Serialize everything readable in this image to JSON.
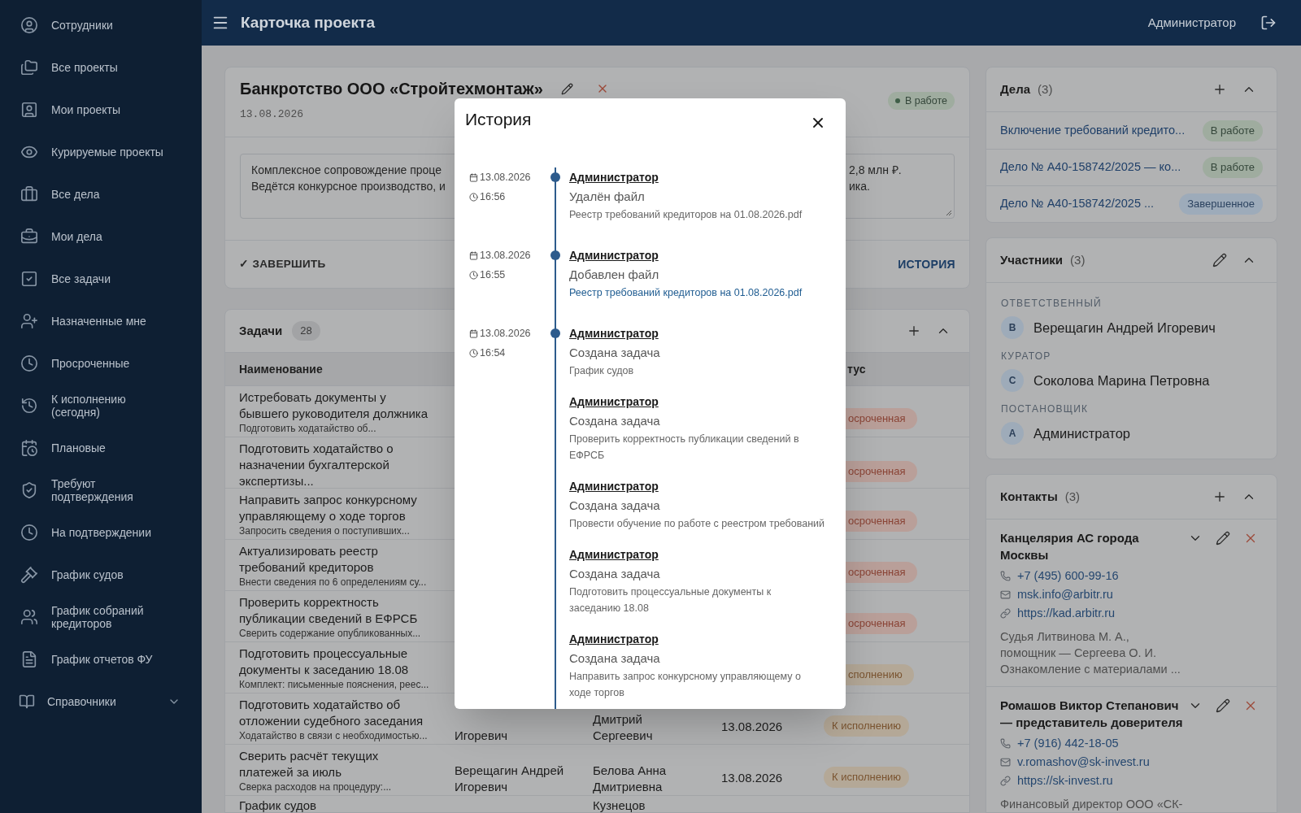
{
  "sidebar": {
    "items": [
      {
        "label": "Сотрудники"
      },
      {
        "label": "Все проекты"
      },
      {
        "label": "Мои проекты"
      },
      {
        "label": "Курируемые проекты"
      },
      {
        "label": "Все дела"
      },
      {
        "label": "Мои дела"
      },
      {
        "label": "Все задачи"
      },
      {
        "label": "Назначенные мне"
      },
      {
        "label": "Просроченные"
      },
      {
        "label": "К исполнению\n(сегодня)"
      },
      {
        "label": "Плановые"
      },
      {
        "label": "Требуют\nподтверждения"
      },
      {
        "label": "На подтверждении"
      },
      {
        "label": "График судов"
      },
      {
        "label": "График собраний\nкредиторов"
      },
      {
        "label": "График отчетов ФУ"
      }
    ],
    "group": {
      "label": "Справочники",
      "expanded": false
    }
  },
  "topbar": {
    "title": "Карточка проекта",
    "user": "Администратор"
  },
  "project": {
    "title": "Банкротство ООО «Стройтехмонтаж»",
    "date": "13.08.2026",
    "status": {
      "label": "В работе",
      "kind": "active"
    },
    "description": {
      "left": "Комплексное сопровождение проце\nВедётся конкурсное производство, и",
      "right": "2,8 млн ₽.\nика."
    },
    "complete_button": "✓ ЗАВЕРШИТЬ",
    "history_button": "ИСТОРИЯ"
  },
  "tasks": {
    "title": "Задачи",
    "count": "28",
    "column_1": "Наименование",
    "column_5": {
      "label": "тус",
      "hidden_start": true
    },
    "rows": [
      {
        "name": "Истребовать документы у\nбывшего руководителя должника",
        "note": "Подготовить ходатайство об...",
        "status": {
          "label": "осроченная",
          "kind": "overdue",
          "hidden_start": true
        }
      },
      {
        "name": "Подготовить ходатайство о\nназначении бухгалтерской\nэкспертизы...",
        "status": {
          "label": "осроченная",
          "kind": "overdue",
          "hidden_start": true
        }
      },
      {
        "name": "Направить запрос конкурсному\nуправляющему о ходе торгов",
        "note": "Запросить сведения о поступивших...",
        "status": {
          "label": "осроченная",
          "kind": "overdue",
          "hidden_start": true
        }
      },
      {
        "name": "Актуализировать реестр\nтребований кредиторов",
        "note": "Внести сведения по 6 определениям су...",
        "status": {
          "label": "осроченная",
          "kind": "overdue",
          "hidden_start": true
        }
      },
      {
        "name": "Проверить корректность\nпубликации сведений в ЕФРСБ",
        "note": "Сверить содержание опубликованных...",
        "status": {
          "label": "осроченная",
          "kind": "overdue",
          "hidden_start": true
        }
      },
      {
        "name": "Подготовить процессуальные\nдокументы к заседанию 18.08",
        "note": "Комплект: письменные пояснения, реес...",
        "status": {
          "label": "сполнению",
          "kind": "todo",
          "hidden_start": true
        }
      },
      {
        "name": "Подготовить ходатайство об\nотложении судебного заседания",
        "note": "Ходатайство в связи с необходимостью...",
        "responsible": "Игоревич",
        "author": "Дмитрий\nСергеевич",
        "date": "13.08.2026",
        "status": {
          "label": "К исполнению",
          "kind": "todo",
          "hidden_start": false
        }
      },
      {
        "name": "Сверить расчёт текущих\nплатежей за июль",
        "note": "Сверка расходов на процедуру:...",
        "responsible": "Верещагин Андрей\nИгоревич",
        "author": "Белова Анна\nДмитриевна",
        "date": "13.08.2026",
        "status": {
          "label": "К исполнению",
          "kind": "todo",
          "hidden_start": false
        }
      },
      {
        "name": "График судов",
        "author": "Кузнецов"
      }
    ]
  },
  "cases": {
    "title": "Дела",
    "count": "(3)",
    "items": [
      {
        "title": "Включение требований кредито...",
        "status": {
          "label": "В работе",
          "kind": "active"
        }
      },
      {
        "title": "Дело № А40-158742/2025 — ко...",
        "status": {
          "label": "В работе",
          "kind": "active"
        }
      },
      {
        "title": "Дело № А40-158742/2025 ...",
        "status": {
          "label": "Завершенное",
          "kind": "done"
        }
      }
    ]
  },
  "participants": {
    "title": "Участники",
    "count": "(3)",
    "roles": [
      {
        "role": "ОТВЕТСТВЕННЫЙ",
        "initial": "В",
        "name": "Верещагин Андрей Игоревич"
      },
      {
        "role": "КУРАТОР",
        "initial": "С",
        "name": "Соколова Марина Петровна"
      },
      {
        "role": "ПОСТАНОВЩИК",
        "initial": "А",
        "name": "Администратор"
      }
    ]
  },
  "contacts": {
    "title": "Контакты",
    "count": "(3)",
    "items": [
      {
        "name": "Канцелярия АС города\nМосквы",
        "phone": "+7 (495) 600-99-16",
        "email": "msk.info@arbitr.ru",
        "url": "https://kad.arbitr.ru",
        "note": "Судья Литвинова М. А.,\nпомощник — Сергеева О. И.\nОзнакомление с материалами ..."
      },
      {
        "name": "Ромашов Виктор Степанович\n— представитель доверителя",
        "phone": "+7 (916) 442-18-05",
        "email": "v.romashov@sk-invest.ru",
        "url": "https://sk-invest.ru",
        "note": "Финансовый директор ООО «СК-"
      }
    ]
  },
  "history": {
    "title": "История",
    "groups": [
      {
        "date": "13.08.2026",
        "time": "16:56",
        "entries": [
          {
            "kind": "text",
            "user": "Администратор",
            "action": "Удалён файл",
            "detail": "Реестр требований кредиторов на 01.08.2026.pdf"
          }
        ]
      },
      {
        "date": "13.08.2026",
        "time": "16:55",
        "entries": [
          {
            "kind": "link",
            "user": "Администратор",
            "action": "Добавлен файл",
            "detail": "Реестр требований кредиторов на 01.08.2026.pdf"
          }
        ]
      },
      {
        "date": "13.08.2026",
        "time": "16:54",
        "entries": [
          {
            "kind": "text",
            "user": "Администратор",
            "action": "Создана задача",
            "detail": "График судов"
          },
          {
            "kind": "text",
            "user": "Администратор",
            "action": "Создана задача",
            "detail": "Проверить корректность публикации сведений в\nЕФРСБ"
          },
          {
            "kind": "text",
            "user": "Администратор",
            "action": "Создана задача",
            "detail": "Провести обучение по работе с реестром требований"
          },
          {
            "kind": "text",
            "user": "Администратор",
            "action": "Создана задача",
            "detail": "Подготовить процессуальные документы к\nзаседанию 18.08"
          },
          {
            "kind": "text",
            "user": "Администратор",
            "action": "Создана задача",
            "detail": "Направить запрос конкурсному управляющему о\nходе торгов"
          }
        ]
      }
    ]
  }
}
